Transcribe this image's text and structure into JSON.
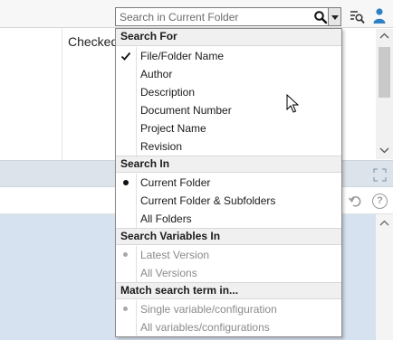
{
  "search": {
    "placeholder": "Search in Current Folder"
  },
  "background": {
    "checked_label": "Checked"
  },
  "menu": {
    "sections": [
      {
        "header": "Search For",
        "items": [
          {
            "label": "File/Folder Name",
            "mark": "check",
            "enabled": true
          },
          {
            "label": "Author",
            "mark": "",
            "enabled": true
          },
          {
            "label": "Description",
            "mark": "",
            "enabled": true
          },
          {
            "label": "Document Number",
            "mark": "",
            "enabled": true
          },
          {
            "label": "Project Name",
            "mark": "",
            "enabled": true
          },
          {
            "label": "Revision",
            "mark": "",
            "enabled": true
          }
        ]
      },
      {
        "header": "Search In",
        "items": [
          {
            "label": "Current Folder",
            "mark": "bullet",
            "enabled": true
          },
          {
            "label": "Current Folder & Subfolders",
            "mark": "",
            "enabled": true
          },
          {
            "label": "All Folders",
            "mark": "",
            "enabled": true
          }
        ]
      },
      {
        "header": "Search Variables In",
        "items": [
          {
            "label": "Latest Version",
            "mark": "bullet",
            "enabled": false
          },
          {
            "label": "All Versions",
            "mark": "",
            "enabled": false
          }
        ]
      },
      {
        "header": "Match search term in...",
        "items": [
          {
            "label": "Single variable/configuration",
            "mark": "bullet",
            "enabled": false
          },
          {
            "label": "All variables/configurations",
            "mark": "",
            "enabled": false
          }
        ]
      }
    ]
  },
  "icons": {
    "search": "magnifier-icon",
    "dropdown": "chevron-down-icon",
    "advanced_search": "advanced-search-icon",
    "user": "user-icon",
    "expand": "expand-icon",
    "undo": "undo-icon",
    "help": "help-icon",
    "help_glyph": "?"
  }
}
